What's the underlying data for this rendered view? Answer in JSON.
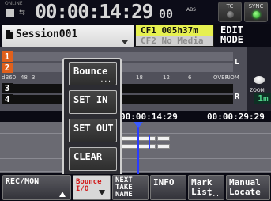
{
  "topbar": {
    "online_label": "ONLINE",
    "counter": "00:00:14:29",
    "counter_frames": "00",
    "abs_label": "ABS",
    "tc_label": "TC",
    "sync_label": "SYNC"
  },
  "session": {
    "name": "Session001",
    "media_line1": "CF1 005h37m",
    "media_line2": "CF2 No Media",
    "mode_line1": "EDIT",
    "mode_line2": "MODE"
  },
  "tracks": [
    {
      "num": "1"
    },
    {
      "num": "2"
    },
    {
      "num": "3"
    },
    {
      "num": "4"
    }
  ],
  "db_scale": [
    "dB60",
    "48",
    "3",
    "18",
    "12",
    "6",
    "OVER",
    "NOM"
  ],
  "lr": {
    "l": "L",
    "r": "R"
  },
  "zoom": {
    "label": "ZOOM",
    "value": "1m"
  },
  "timeline": {
    "tc_start": "00:00:14:29",
    "tc_end": "00:00:29:29"
  },
  "popup": {
    "items": [
      {
        "label": "Bounce",
        "ellipsis": "..."
      },
      {
        "label": "SET IN"
      },
      {
        "label": "SET OUT"
      },
      {
        "label": "CLEAR"
      }
    ]
  },
  "bottom": {
    "rec_mon": "REC/MON",
    "bounce_1": "Bounce",
    "bounce_2": "I/O",
    "next_1": "NEXT",
    "next_2": "TAKE",
    "next_3": "NAME",
    "info": "INFO",
    "mark_1": "Mark",
    "mark_2": "List",
    "manual_1": "Manual",
    "manual_2": "Locate",
    "ellipsis": "..."
  },
  "colors": {
    "track_armed": "#e0601c",
    "media_active": "#e6f050",
    "playhead": "#2a3cff",
    "sync_led": "#3f3",
    "bounce_text": "#d21a1a"
  }
}
